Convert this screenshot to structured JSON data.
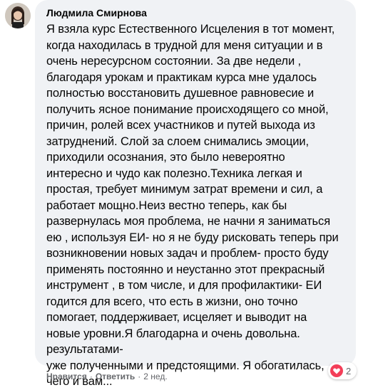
{
  "comment": {
    "author": "Людмила Смирнова",
    "text": "Я взяла курс Естественного Исцеления в тот момент,\nкогда находилась в трудной для меня ситуации и в\nочень нересурсном состоянии. За две недели ,\nблагодаря урокам и практикам курса мне удалось\nполностью восстановить душевное равновесие и\nполучить ясное понимание происходящего со мной,\nпричин, ролей всех участников и путей выхода из\nзатруднений. Слой за слоем снимались эмоции,\nприходили осознания, это было невероятно\nинтересно и чудо как полезно.Техника легкая и\nпростая, требует минимум затрат времени и сил, а\nработает мощно.Неиз вестно теперь, как бы\nразвернулась моя проблема, не начни я заниматься\nею , используя ЕИ- но я не буду рисковать теперь при\nвозникновении новых задач и проблем- просто буду\nприменять постоянно и неустанно этот прекрасный\nинструмент , в том числе, и для профилактики- ЕИ\nгодится для всего, что есть в жизни, оно точно\nпомогает, поддерживает, исцеляет и выводит на\nновые уровни.Я благодарна и очень довольна.\nрезультатами-\nуже полученными и предстоящими. Я обогатилась,\nчего и вам...",
    "reactions": {
      "icon": "heart-reaction-icon",
      "count": "2",
      "color": "#f33e58"
    },
    "actions": {
      "like_label": "Нравится",
      "separator": "·",
      "reply_label": "Ответить",
      "time": "2 нед."
    }
  }
}
